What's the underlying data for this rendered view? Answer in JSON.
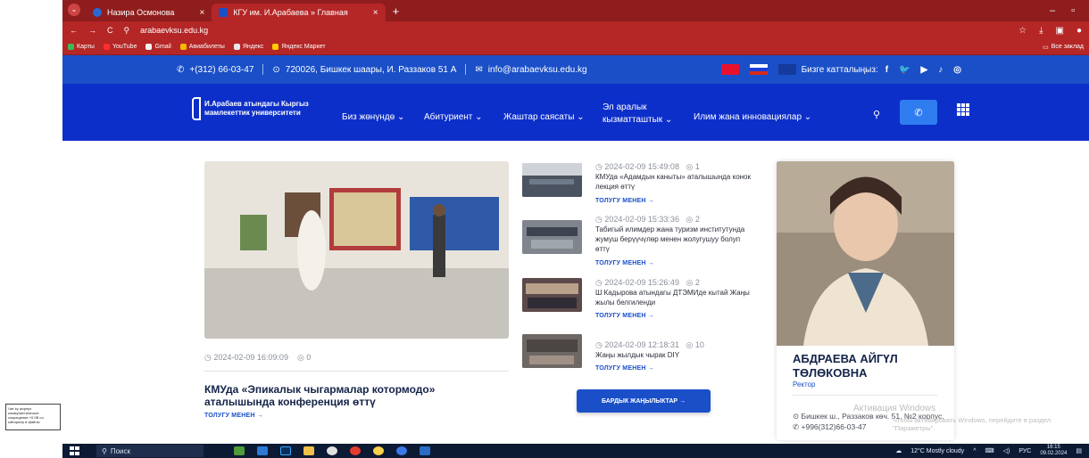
{
  "side_card": {
    "text": "Чат ky жорпуо коммунистическое сокращение +0.0В со ыйгарылу в файлы"
  },
  "browser": {
    "tabs": [
      {
        "label": "Назира Осмонова",
        "close": "×"
      },
      {
        "label": "КГУ им. И.Арабаева » Главная",
        "close": "×"
      }
    ],
    "new_tab": "+",
    "url": "arabaevksu.edu.kg",
    "nav_back": "←",
    "nav_forward": "→",
    "nav_reload": "C",
    "win_minimize": "–",
    "win_restore": "▫",
    "bookmarks": [
      "Карты",
      "YouTube",
      "Gmail",
      "Авиабилеты",
      "Яндекс",
      "Яндекс Маркет"
    ],
    "all_bookmarks": "Все заклад"
  },
  "topbar": {
    "phone": "+(312) 66-03-47",
    "address": "720026, Бишкек шаары, И. Раззаков 51 А",
    "email": "info@arabaevksu.edu.kg",
    "follow_label": "Бизге катталыңыз:",
    "social": [
      "f",
      "🐦",
      "▶",
      "♪",
      "◎"
    ]
  },
  "nav": {
    "logo_line1": "И.Арабаев атындагы Кыргыз",
    "logo_line2": "мамлекеттик университети",
    "items": [
      "Биз жөнүндө ⌄",
      "Абитуриент ⌄",
      "Жаштар саясаты ⌄",
      "Эл аралык кызматташтык ⌄",
      "Илим жана инновациялар ⌄"
    ]
  },
  "featured": {
    "date": "2024-02-09 16:09:09",
    "views": "0",
    "title": "КМУда «Эпикалык чыгармалар котормодо» аталышында конференция өттү",
    "more": "ТОЛУГУ МЕНЕН →"
  },
  "news": [
    {
      "date": "2024-02-09 15:49:08",
      "views": "1",
      "title": "КМУда «Адамдын каныты» аталышында конок лекция өттү",
      "more": "ТОЛУГУ МЕНЕН →"
    },
    {
      "date": "2024-02-09 15:33:36",
      "views": "2",
      "title": "Табигый илимдер жана туризм институтунда жумуш берүүчүлөр менен жолугушуу болуп өттү",
      "more": "ТОЛУГУ МЕНЕН →"
    },
    {
      "date": "2024-02-09 15:26:49",
      "views": "2",
      "title": "Ш Кадырова атындагы ДТЭМИде кытай Жаңы жылы белгиленди",
      "more": "ТОЛУГУ МЕНЕН →"
    },
    {
      "date": "2024-02-09 12:18:31",
      "views": "10",
      "title": "Жаңы жылдык чырак DIY",
      "more": "ТОЛУГУ МЕНЕН →"
    }
  ],
  "all_news_button": "БАРДЫК ЖАҢЫЛЫКТАР →",
  "rector": {
    "name": "АБДРАЕВА АЙГҮЛ ТӨЛӨКОВНА",
    "role": "Ректор",
    "address": "Бишкек ш., Раззаков көч. 51, №2 корпус.",
    "phone": "+996(312)66-03-47"
  },
  "watermark": {
    "line1": "Активация Windows",
    "line2": "Чтобы активировать Windows, перейдите в раздел \"Параметры\"."
  },
  "taskbar": {
    "search": "Поиск",
    "weather": "12°C Mostly cloudy",
    "lang": "РУС",
    "time": "16:15",
    "date": "09.02.2024"
  }
}
